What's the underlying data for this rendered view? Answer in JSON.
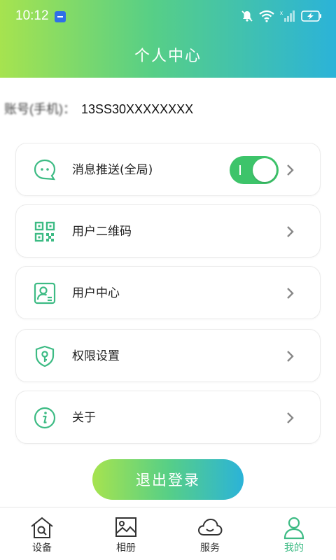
{
  "statusbar": {
    "time": "10:12"
  },
  "header": {
    "title": "个人中心"
  },
  "account": {
    "label": "账号(手机)：",
    "value": "13SS30XXXXXXXX"
  },
  "menu": {
    "push": {
      "label": "消息推送(全局)",
      "toggle_on": true
    },
    "qrcode": {
      "label": "用户二维码"
    },
    "user_center": {
      "label": "用户中心"
    },
    "permissions": {
      "label": "权限设置"
    },
    "about": {
      "label": "关于"
    }
  },
  "logout_label": "退出登录",
  "tabs": [
    {
      "label": "设备",
      "icon": "home-search-icon"
    },
    {
      "label": "相册",
      "icon": "image-icon"
    },
    {
      "label": "服务",
      "icon": "cloud-icon"
    },
    {
      "label": "我的",
      "icon": "person-icon",
      "active": true
    }
  ],
  "colors": {
    "gradient_start": "#a6e34f",
    "gradient_end": "#2bb3d8",
    "accent_green": "#3dbb84",
    "toggle_on": "#3dc46a"
  }
}
